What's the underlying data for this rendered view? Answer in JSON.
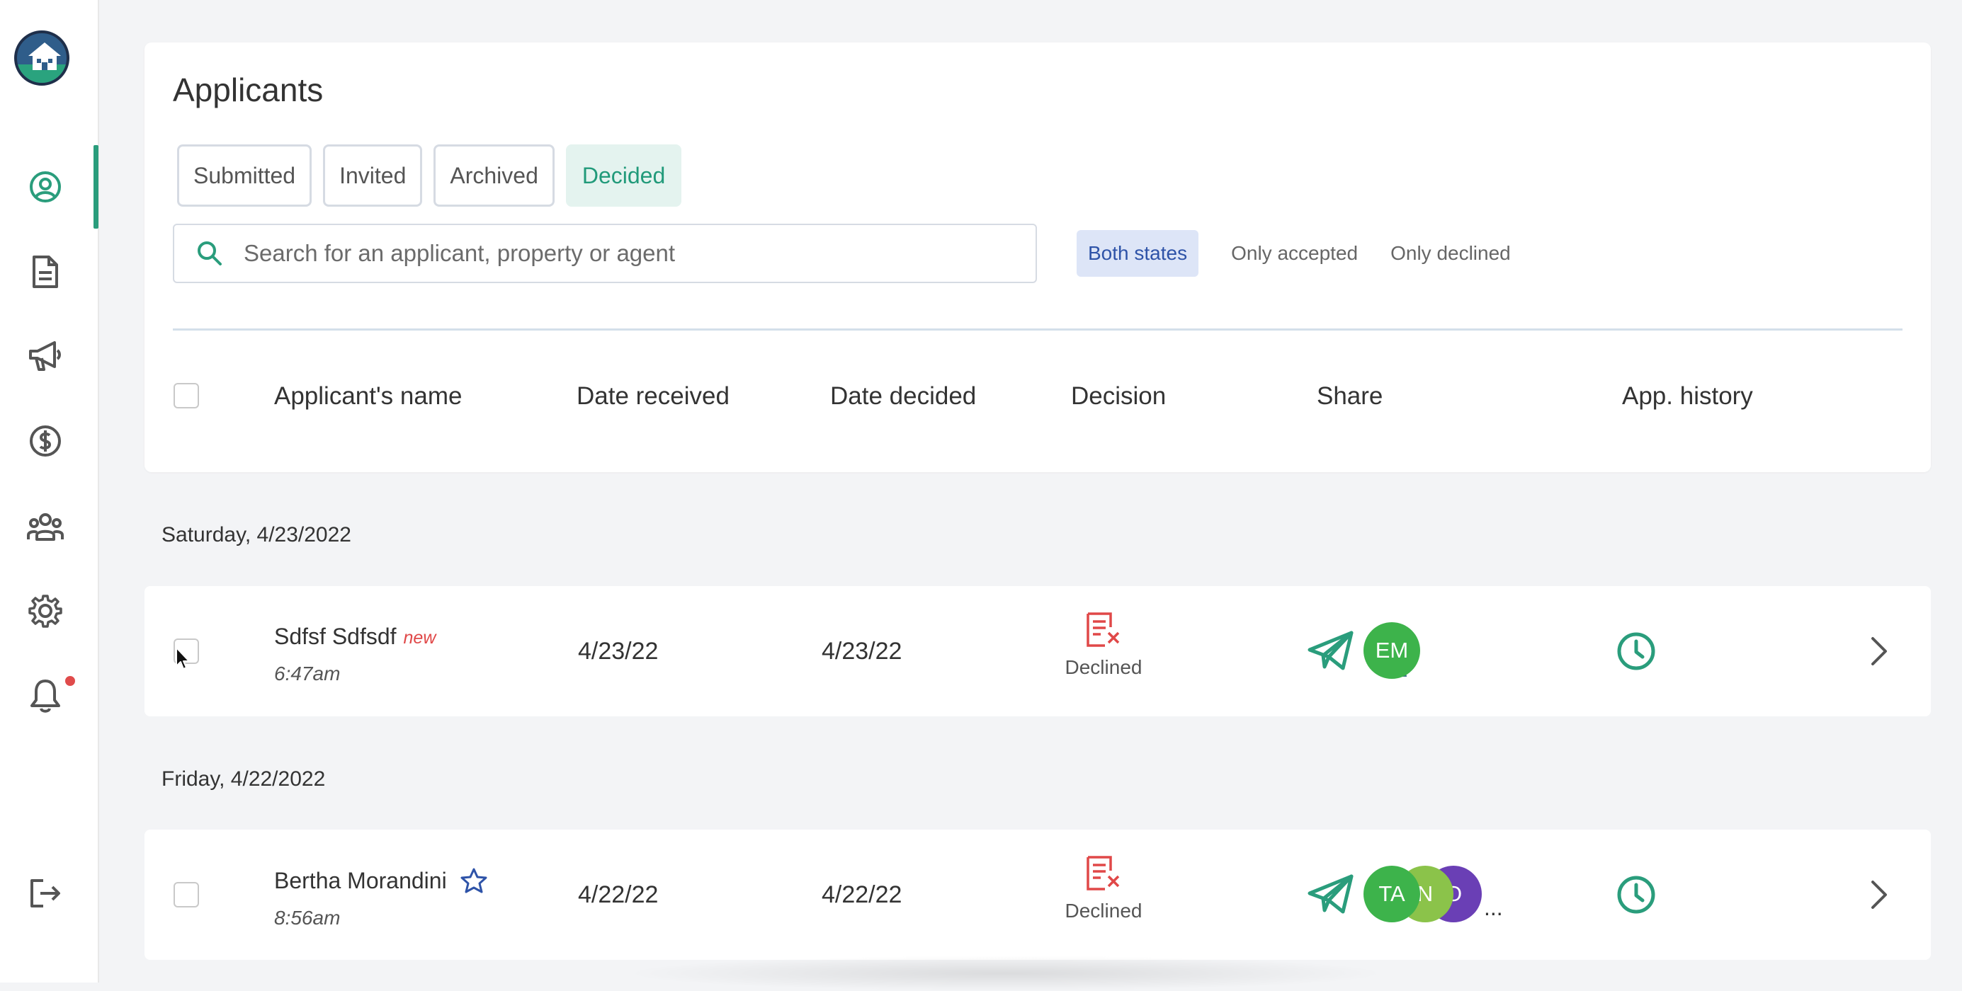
{
  "page": {
    "title": "Applicants",
    "tabs": [
      {
        "label": "Submitted",
        "active": false
      },
      {
        "label": "Invited",
        "active": false
      },
      {
        "label": "Archived",
        "active": false
      },
      {
        "label": "Decided",
        "active": true
      }
    ],
    "search": {
      "placeholder": "Search for an applicant, property or agent",
      "value": ""
    },
    "filters": [
      {
        "label": "Both states",
        "active": true
      },
      {
        "label": "Only accepted",
        "active": false
      },
      {
        "label": "Only declined",
        "active": false
      }
    ],
    "columns": [
      "Applicant's name",
      "Date received",
      "Date decided",
      "Decision",
      "Share",
      "App. history"
    ]
  },
  "sidebar": {
    "items": [
      {
        "icon": "user-circle-icon",
        "active": true
      },
      {
        "icon": "document-icon",
        "active": false
      },
      {
        "icon": "megaphone-icon",
        "active": false
      },
      {
        "icon": "dollar-circle-icon",
        "active": false
      },
      {
        "icon": "people-group-icon",
        "active": false
      },
      {
        "icon": "gear-icon",
        "active": false
      },
      {
        "icon": "bell-icon",
        "active": false,
        "has_notification": true
      },
      {
        "icon": "logout-icon",
        "active": false
      }
    ]
  },
  "groups": [
    {
      "date_label": "Saturday, 4/23/2022",
      "rows": [
        {
          "name": "Sdfsf Sdfsdf",
          "badge": "new",
          "starred": false,
          "time": "6:47am",
          "date_received": "4/23/22",
          "date_decided": "4/23/22",
          "decision": "Declined",
          "share_avatars": [
            {
              "initials": "EM",
              "color": "#3db34b"
            },
            {
              "initials": "",
              "color": "#8a6a55",
              "photo": true
            }
          ],
          "more": ""
        }
      ]
    },
    {
      "date_label": "Friday, 4/22/2022",
      "rows": [
        {
          "name": "Bertha Morandini",
          "badge": "",
          "starred": true,
          "time": "8:56am",
          "date_received": "4/22/22",
          "date_decided": "4/22/22",
          "decision": "Declined",
          "share_avatars": [
            {
              "initials": "TA",
              "color": "#3db34b"
            },
            {
              "initials": "N",
              "color": "#8bc34a"
            },
            {
              "initials": "O",
              "color": "#6a3fb5"
            }
          ],
          "more": "..."
        }
      ]
    }
  ],
  "colors": {
    "accent": "#2a9d7c",
    "declined": "#e04848",
    "star": "#2e53a8",
    "notification": "#e04b4b"
  }
}
